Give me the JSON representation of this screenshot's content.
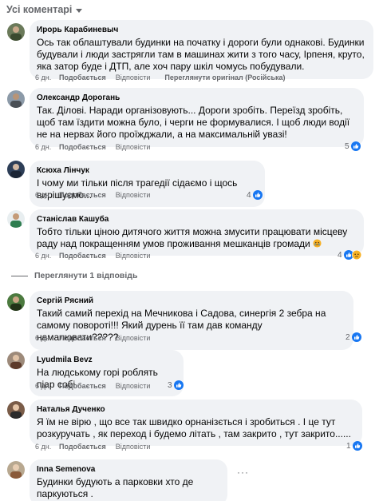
{
  "filter": {
    "label": "Усі коментарі"
  },
  "comments": [
    {
      "author": "Ирорь Карабиневыч",
      "text": "Ось так облаштували будинки на початку і дороги були однакові. Будинки будували і люди застрягли там в машинах жити з того часу, Ірпеня, круто, яка затор буде і ДТП, але хоч пару шкіл чомусь побудували.",
      "time": "6 дн.",
      "like": "Подобається",
      "reply": "Відповісти",
      "translate": "Переглянути оригінал (Російська)"
    },
    {
      "author": "Олександр Дорогань",
      "text": "Так. Ділові. Наради організовують... Дороги зробіть. Переїзд зробіть, щоб там їздити можна було, і черги не формувалися. І щоб люди водії не на нервах його проїжджали, а на максимальній увазі!",
      "time": "6 дн.",
      "like": "Подобається",
      "reply": "Відповісти",
      "reactions": "5"
    },
    {
      "author": "Ксюха Лінчук",
      "text": "І чому ми тільки після трагедії сідаємо і щось вирішуємо...",
      "time": "6 дн.",
      "like": "Подобається",
      "reply": "Відповісти",
      "reactions": "4"
    },
    {
      "author": "Станіслав Кашуба",
      "text": "Тобто тільки ціною дитячого життя можна змусити працювати місцеву раду над покращенням умов проживання мешканців громади",
      "time": "6 дн.",
      "like": "Подобається",
      "reply": "Відповісти",
      "reactions": "4"
    },
    {
      "author": "Сергій Рясний",
      "text": "Такий самий перехід на Мечникова і Садова, синергія 2 зебра на самому повороті!!! Який дурень її там дав команду намалювати?????",
      "time": "6 дн.",
      "like": "Подобається",
      "reply": "Відповісти",
      "reactions": "2"
    },
    {
      "author": "Lyudmila Bevz",
      "text": "На людському горі роблять піар собі.",
      "time": "6 дн.",
      "like": "Подобається",
      "reply": "Відповісти",
      "reactions": "3"
    },
    {
      "author": "Наталья Дученко",
      "text": "Я їм не вірю , що все так швидко орнанізється і зробиться . І це тут розкуручать , як переход і будемо літать , там закрито , тут закрито......",
      "time": "6 дн.",
      "like": "Подобається",
      "reply": "Відповісти",
      "reactions": "1"
    },
    {
      "author": "Inna Semenova",
      "text": "Будинки будують а парковки хто де паркуються .",
      "more": "···"
    }
  ],
  "view_replies": "Переглянути 1 відповідь",
  "colors": {
    "bubble": "#f0f2f5",
    "meta": "#65676b",
    "like_blue": "#1877f2",
    "haha_yellow": "#f7b125"
  }
}
